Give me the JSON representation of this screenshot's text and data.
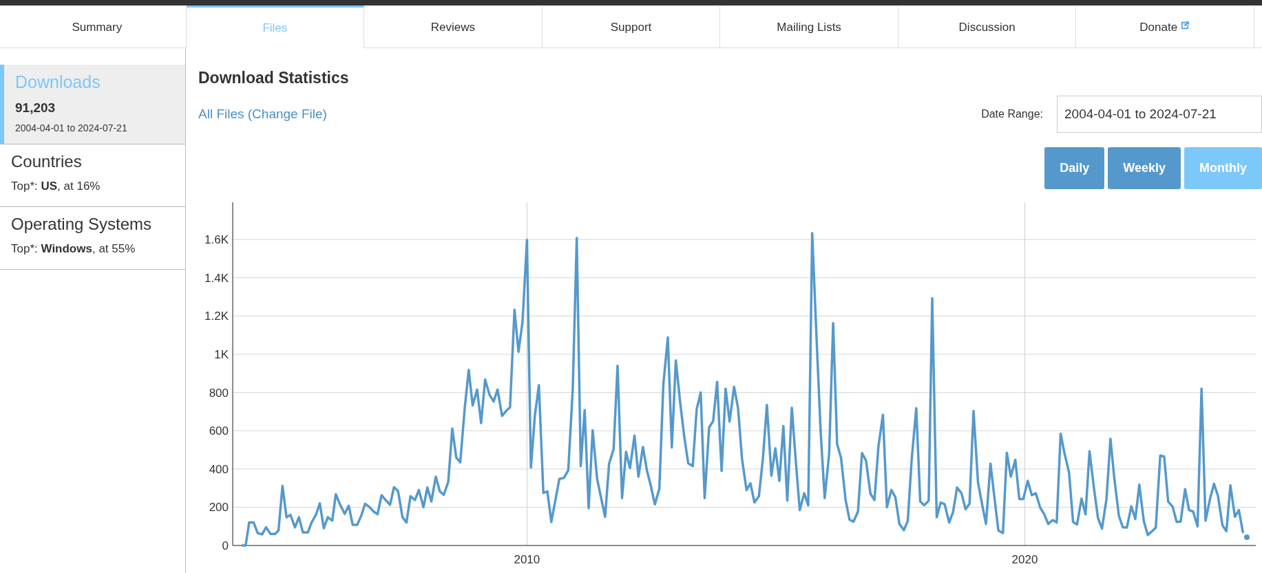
{
  "tabs": [
    {
      "label": "Summary",
      "selected": false,
      "external": false
    },
    {
      "label": "Files",
      "selected": true,
      "external": false
    },
    {
      "label": "Reviews",
      "selected": false,
      "external": false
    },
    {
      "label": "Support",
      "selected": false,
      "external": false
    },
    {
      "label": "Mailing Lists",
      "selected": false,
      "external": false
    },
    {
      "label": "Discussion",
      "selected": false,
      "external": false
    },
    {
      "label": "Donate",
      "selected": false,
      "external": true
    }
  ],
  "sidebar": {
    "items": [
      {
        "kind": "total",
        "title": "Downloads",
        "value": "91,203",
        "range": "2004-04-01 to 2024-07-21",
        "selected": true
      },
      {
        "kind": "top",
        "title": "Countries",
        "summary": "Top*: **US**, at 16%",
        "selected": false
      },
      {
        "kind": "top",
        "title": "Operating Systems",
        "summary": "Top*: **Windows**, at 55%",
        "selected": false
      }
    ]
  },
  "main": {
    "title": "Download Statistics",
    "file_link": "All Files (Change File)",
    "date_range": {
      "label": "Date Range:",
      "value": "2004-04-01 to 2024-07-21"
    },
    "intervals": [
      {
        "label": "Daily",
        "selected": false
      },
      {
        "label": "Weekly",
        "selected": false
      },
      {
        "label": "Monthly",
        "selected": true
      }
    ],
    "chart_data": {
      "type": "line",
      "grid": true,
      "xlim": [
        2004.09,
        2024.64
      ],
      "ylim": [
        0,
        1795
      ],
      "xticks": [
        2010,
        2020
      ],
      "yticks": [
        0,
        200,
        400,
        600,
        800,
        {
          "value": 1000,
          "label": "1K"
        },
        {
          "value": 1200,
          "label": "1.2K"
        },
        {
          "value": 1400,
          "label": "1.4K"
        },
        {
          "value": 1600,
          "label": "1.6K"
        }
      ],
      "x": [
        2004.28,
        2004.35,
        2004.42,
        2004.51,
        2004.59,
        2004.68,
        2004.76,
        2004.85,
        2004.94,
        2005.01,
        2005.09,
        2005.17,
        2005.25,
        2005.34,
        2005.42,
        2005.5,
        2005.6,
        2005.67,
        2005.76,
        2005.84,
        2005.92,
        2006.0,
        2006.09,
        2006.16,
        2006.24,
        2006.34,
        2006.42,
        2006.5,
        2006.59,
        2006.67,
        2006.75,
        2006.83,
        2006.92,
        2007.0,
        2007.08,
        2007.16,
        2007.25,
        2007.33,
        2007.41,
        2007.5,
        2007.58,
        2007.66,
        2007.75,
        2007.83,
        2007.92,
        2008.0,
        2008.08,
        2008.17,
        2008.25,
        2008.33,
        2008.42,
        2008.5,
        2008.58,
        2008.66,
        2008.75,
        2008.83,
        2008.91,
        2009.0,
        2009.08,
        2009.16,
        2009.25,
        2009.33,
        2009.41,
        2009.5,
        2009.58,
        2009.66,
        2009.75,
        2009.83,
        2009.91,
        2010.0,
        2010.08,
        2010.16,
        2010.24,
        2010.33,
        2010.41,
        2010.49,
        2010.65,
        2010.74,
        2010.83,
        2010.92,
        2011.0,
        2011.08,
        2011.16,
        2011.24,
        2011.32,
        2011.41,
        2011.57,
        2011.65,
        2011.74,
        2011.82,
        2011.91,
        2011.99,
        2012.07,
        2012.16,
        2012.24,
        2012.33,
        2012.41,
        2012.49,
        2012.57,
        2012.66,
        2012.74,
        2012.83,
        2012.91,
        2012.99,
        2013.08,
        2013.16,
        2013.24,
        2013.33,
        2013.41,
        2013.49,
        2013.57,
        2013.66,
        2013.74,
        2013.82,
        2013.91,
        2013.99,
        2014.07,
        2014.16,
        2014.24,
        2014.32,
        2014.41,
        2014.49,
        2014.57,
        2014.66,
        2014.74,
        2014.82,
        2014.91,
        2014.99,
        2015.07,
        2015.15,
        2015.23,
        2015.32,
        2015.4,
        2015.48,
        2015.57,
        2015.65,
        2015.73,
        2015.82,
        2015.9,
        2015.98,
        2016.07,
        2016.15,
        2016.23,
        2016.31,
        2016.4,
        2016.48,
        2016.56,
        2016.65,
        2016.73,
        2016.81,
        2016.9,
        2016.98,
        2017.06,
        2017.15,
        2017.23,
        2017.32,
        2017.4,
        2017.48,
        2017.57,
        2017.65,
        2017.73,
        2017.82,
        2017.9,
        2017.98,
        2018.07,
        2018.14,
        2018.23,
        2018.31,
        2018.39,
        2018.48,
        2018.56,
        2018.64,
        2018.73,
        2018.81,
        2018.89,
        2018.97,
        2019.06,
        2019.14,
        2019.22,
        2019.31,
        2019.39,
        2019.47,
        2019.56,
        2019.64,
        2019.72,
        2019.81,
        2019.89,
        2019.97,
        2020.06,
        2020.14,
        2020.22,
        2020.31,
        2020.39,
        2020.47,
        2020.56,
        2020.64,
        2020.72,
        2020.8,
        2020.89,
        2020.97,
        2021.05,
        2021.14,
        2021.22,
        2021.3,
        2021.39,
        2021.47,
        2021.55,
        2021.64,
        2021.72,
        2021.8,
        2021.89,
        2021.97,
        2022.05,
        2022.14,
        2022.22,
        2022.3,
        2022.39,
        2022.47,
        2022.55,
        2022.63,
        2022.72,
        2022.8,
        2022.88,
        2022.97,
        2023.05,
        2023.13,
        2023.22,
        2023.3,
        2023.38,
        2023.47,
        2023.55,
        2023.63,
        2023.72,
        2023.8,
        2023.88,
        2023.97,
        2024.05,
        2024.13,
        2024.22,
        2024.3,
        2024.38,
        2024.42,
        2024.46
      ],
      "series": [
        {
          "color": "#5599cc",
          "values": [
            0,
            0,
            120,
            120,
            65,
            58,
            95,
            60,
            60,
            78,
            312,
            148,
            160,
            95,
            148,
            68,
            68,
            118,
            160,
            220,
            90,
            148,
            130,
            268,
            218,
            165,
            208,
            108,
            108,
            155,
            218,
            203,
            178,
            163,
            263,
            238,
            213,
            305,
            285,
            148,
            120,
            258,
            238,
            290,
            200,
            303,
            230,
            360,
            283,
            265,
            333,
            612,
            460,
            435,
            718,
            918,
            733,
            815,
            640,
            868,
            788,
            753,
            815,
            678,
            703,
            723,
            1233,
            1013,
            1168,
            1598,
            408,
            680,
            838,
            275,
            283,
            123,
            348,
            353,
            393,
            818,
            1608,
            415,
            708,
            195,
            603,
            348,
            150,
            428,
            503,
            940,
            248,
            490,
            405,
            575,
            360,
            515,
            393,
            310,
            215,
            298,
            843,
            1088,
            513,
            968,
            743,
            568,
            430,
            415,
            713,
            800,
            248,
            618,
            650,
            855,
            390,
            820,
            648,
            830,
            718,
            455,
            290,
            325,
            225,
            258,
            455,
            735,
            365,
            508,
            338,
            625,
            235,
            720,
            445,
            185,
            273,
            210,
            1633,
            1068,
            593,
            248,
            480,
            1163,
            530,
            458,
            238,
            135,
            125,
            178,
            483,
            445,
            270,
            238,
            518,
            683,
            200,
            290,
            253,
            113,
            80,
            128,
            455,
            718,
            230,
            210,
            235,
            1293,
            148,
            225,
            215,
            120,
            175,
            303,
            273,
            190,
            218,
            703,
            330,
            218,
            113,
            428,
            250,
            78,
            65,
            485,
            360,
            448,
            243,
            243,
            338,
            263,
            273,
            198,
            163,
            113,
            133,
            120,
            585,
            480,
            380,
            123,
            110,
            245,
            163,
            493,
            298,
            143,
            88,
            243,
            558,
            348,
            155,
            95,
            93,
            205,
            138,
            318,
            128,
            55,
            73,
            93,
            470,
            465,
            230,
            203,
            123,
            125,
            295,
            185,
            178,
            100,
            820,
            130,
            243,
            323,
            260,
            105,
            75,
            315,
            150,
            185,
            70,
            null,
            43
          ]
        }
      ]
    }
  }
}
